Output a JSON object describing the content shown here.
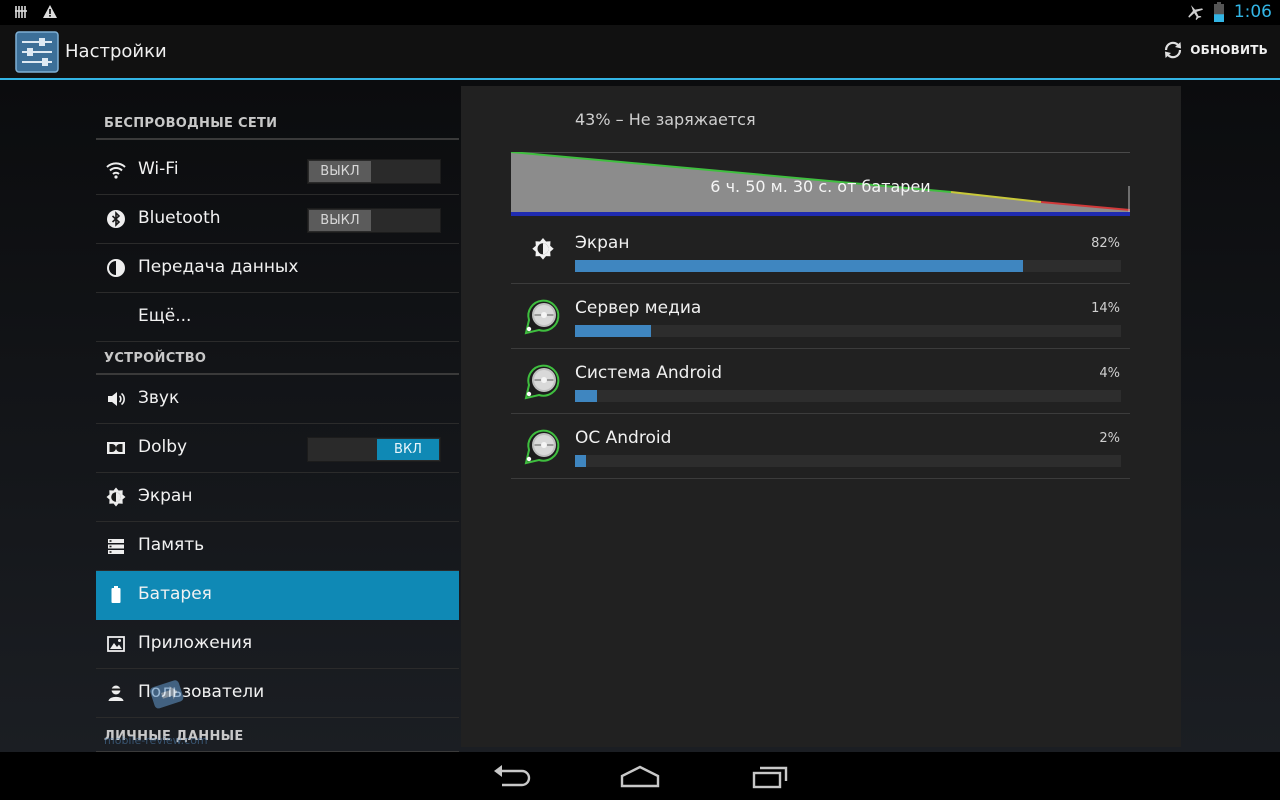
{
  "status_bar": {
    "time": "1:06",
    "icons": [
      "usb-debug-icon",
      "warning-icon",
      "airplane-icon",
      "battery-icon"
    ]
  },
  "action_bar": {
    "title": "Настройки",
    "refresh_label": "ОБНОВИТЬ",
    "app_icon": "settings-sliders-icon"
  },
  "sidebar": {
    "sections": {
      "wireless": "БЕСПРОВОДНЫЕ СЕТИ",
      "device": "УСТРОЙСТВО",
      "personal": "ЛИЧНЫЕ ДАННЫЕ"
    },
    "items": {
      "wifi": {
        "label": "Wi-Fi",
        "toggle": "ВЫКЛ",
        "on": false
      },
      "bluetooth": {
        "label": "Bluetooth",
        "toggle": "ВЫКЛ",
        "on": false
      },
      "data": {
        "label": "Передача данных"
      },
      "more": {
        "label": "Ещё..."
      },
      "sound": {
        "label": "Звук"
      },
      "dolby": {
        "label": "Dolby",
        "toggle": "ВКЛ",
        "on": true
      },
      "display": {
        "label": "Экран"
      },
      "storage": {
        "label": "Память"
      },
      "battery": {
        "label": "Батарея",
        "selected": true
      },
      "apps": {
        "label": "Приложения"
      },
      "users": {
        "label": "Пользователи"
      }
    },
    "selected_color": "#0f89b5"
  },
  "battery": {
    "status": "43% – Не заряжается",
    "graph_label": "6 ч. 50 м. 30 с. от батареи",
    "level_percent": 43,
    "usage": [
      {
        "name": "Экран",
        "percent_label": "82%",
        "percent": 82,
        "icon": "brightness-icon"
      },
      {
        "name": "Сервер медиа",
        "percent_label": "14%",
        "percent": 14,
        "icon": "android-system-icon"
      },
      {
        "name": "Система Android",
        "percent_label": "4%",
        "percent": 4,
        "icon": "android-system-icon"
      },
      {
        "name": "ОС Android",
        "percent_label": "2%",
        "percent": 2,
        "icon": "android-system-icon"
      }
    ],
    "bar_color": "#3f86c0"
  },
  "watermark": {
    "text": "mobile-review.com"
  },
  "accent_color": "#33b5e5"
}
